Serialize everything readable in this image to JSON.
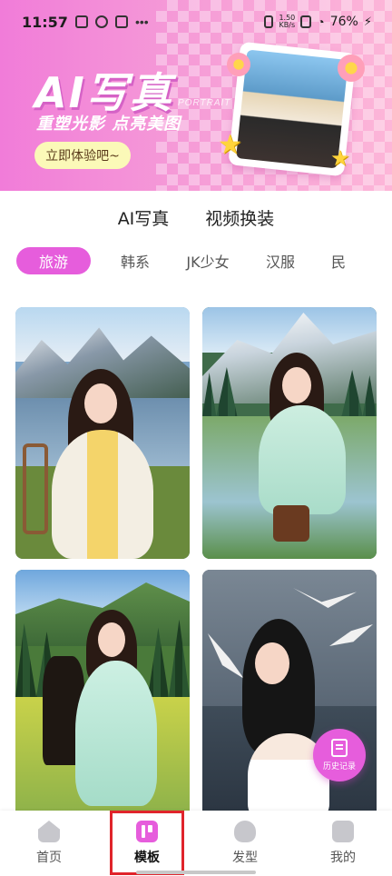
{
  "status_bar": {
    "time": "11:57",
    "net_speed": "1.50",
    "net_unit": "KB/s",
    "battery": "76%"
  },
  "banner": {
    "title": "AI写真",
    "subtitle": "重塑光影 点亮美图",
    "english_caption": "PORTRAIT PHOTOGRAPHY",
    "cta_label": "立即体验吧~"
  },
  "tabs": [
    {
      "label": "AI写真",
      "active": true
    },
    {
      "label": "视频换装",
      "active": false
    }
  ],
  "categories": [
    {
      "label": "旅游",
      "active": true
    },
    {
      "label": "韩系",
      "active": false
    },
    {
      "label": "JK少女",
      "active": false
    },
    {
      "label": "汉服",
      "active": false
    },
    {
      "label": "民",
      "active": false
    }
  ],
  "history_button": {
    "label": "历史记录"
  },
  "bottom_nav": [
    {
      "label": "首页",
      "icon": "home-icon",
      "active": false
    },
    {
      "label": "模板",
      "icon": "template-icon",
      "active": true
    },
    {
      "label": "发型",
      "icon": "hairstyle-icon",
      "active": false
    },
    {
      "label": "我的",
      "icon": "profile-icon",
      "active": false
    }
  ],
  "colors": {
    "accent": "#e65ddc",
    "cta_bg": "#fbf9b8",
    "highlight_box": "#e0242b"
  }
}
